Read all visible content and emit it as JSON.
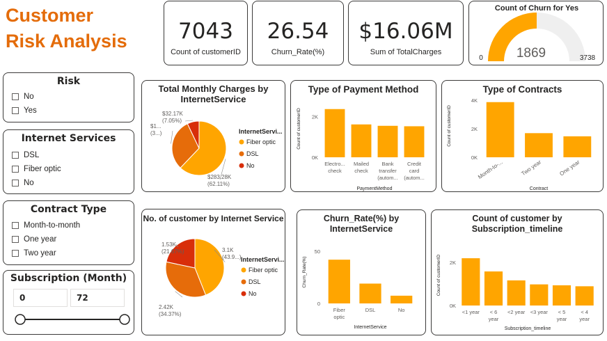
{
  "page": {
    "title_line1": "Customer",
    "title_line2": "Risk Analysis"
  },
  "colors": {
    "primary": "#ffa500",
    "secondary": "#e66c0a",
    "tertiary": "#d82e0a",
    "title": "#e46c0a",
    "track": "#efefef"
  },
  "kpis": [
    {
      "value": "7043",
      "label": "Count of customerID"
    },
    {
      "value": "26.54",
      "label": "Churn_Rate(%)"
    },
    {
      "value": "$16.06M",
      "label": "Sum of TotalCharges"
    }
  ],
  "gauge": {
    "title": "Count of Churn for Yes",
    "value": 1869,
    "min": 0,
    "max": 3738,
    "value_text": "1869",
    "min_text": "0",
    "max_text": "3738"
  },
  "slicers": {
    "risk": {
      "title": "Risk",
      "options": [
        "No",
        "Yes"
      ]
    },
    "internet": {
      "title": "Internet Services",
      "options": [
        "DSL",
        "Fiber optic",
        "No"
      ]
    },
    "contract": {
      "title": "Contract Type",
      "options": [
        "Month-to-month",
        "One year",
        "Two year"
      ]
    },
    "subscription": {
      "title": "Subscription (Month)",
      "min": "0",
      "max": "72"
    }
  },
  "chart_data": [
    {
      "type": "pie",
      "title_line1": "Total Monthly Charges by",
      "title_line2": "InternetService",
      "legend_title": "InternetServi...",
      "slices": [
        {
          "name": "Fiber optic",
          "value": 283.28,
          "label1": "$283.28K",
          "label2": "(62.11%)",
          "percent": 62.11
        },
        {
          "name": "DSL",
          "value": 140.62,
          "label1": "$1...",
          "label2": "(3...)",
          "percent": 30.84
        },
        {
          "name": "No",
          "value": 32.17,
          "label1": "$32.17K",
          "label2": "(7.05%)",
          "percent": 7.05
        }
      ]
    },
    {
      "type": "bar",
      "title": "Type of Payment Method",
      "xlabel": "PaymentMethod",
      "ylabel": "Count of customerID",
      "yticks": [
        "0K",
        "2K"
      ],
      "ylim": [
        0,
        2800
      ],
      "categories": [
        [
          "Electro...",
          "check"
        ],
        [
          "Mailed",
          "check"
        ],
        [
          "Bank",
          "transfer",
          "(autom..."
        ],
        [
          "Credit",
          "card",
          "(autom..."
        ]
      ],
      "values": [
        2365,
        1612,
        1544,
        1522
      ]
    },
    {
      "type": "bar",
      "title": "Type of Contracts",
      "xlabel": "Contract",
      "ylabel": "Count of customerID",
      "yticks": [
        "0K",
        "2K",
        "4K"
      ],
      "ylim": [
        0,
        4400
      ],
      "categories": [
        "Month-to-...",
        "Two year",
        "One year"
      ],
      "values": [
        3875,
        1695,
        1473
      ]
    },
    {
      "type": "pie",
      "title": "No. of customer by Internet Service",
      "legend_title": "InternetServi...",
      "slices": [
        {
          "name": "Fiber optic",
          "value": 3.1,
          "label1": "3.1K",
          "label2": "(43.9...)",
          "percent": 43.96
        },
        {
          "name": "DSL",
          "value": 2.42,
          "label1": "2.42K",
          "label2": "(34.37%)",
          "percent": 34.37
        },
        {
          "name": "No",
          "value": 1.53,
          "label1": "1.53K",
          "label2": "(21.67%)",
          "percent": 21.67
        }
      ]
    },
    {
      "type": "bar",
      "title_line1": "Churn_Rate(%) by",
      "title_line2": "InternetService",
      "xlabel": "InternetService",
      "ylabel": "Churn_Rate(%)",
      "yticks": [
        "0",
        "50"
      ],
      "ylim": [
        0,
        60
      ],
      "categories": [
        [
          "Fiber",
          "optic"
        ],
        "DSL",
        "No"
      ],
      "values": [
        41.9,
        19.0,
        7.4
      ]
    },
    {
      "type": "bar",
      "title_line1": "Count of customer by",
      "title_line2": "Subscription_timeline",
      "xlabel": "Subscription_timeline",
      "ylabel": "Count of customerID",
      "yticks": [
        "0K",
        "2K"
      ],
      "ylim": [
        0,
        2800
      ],
      "categories": [
        "<1 year",
        [
          "< 6",
          "year"
        ],
        "<2 year",
        "<3 year",
        [
          "< 5",
          "year"
        ],
        [
          "< 4",
          "year"
        ]
      ],
      "values": [
        2186,
        1575,
        1162,
        977,
        934,
        890
      ]
    }
  ]
}
